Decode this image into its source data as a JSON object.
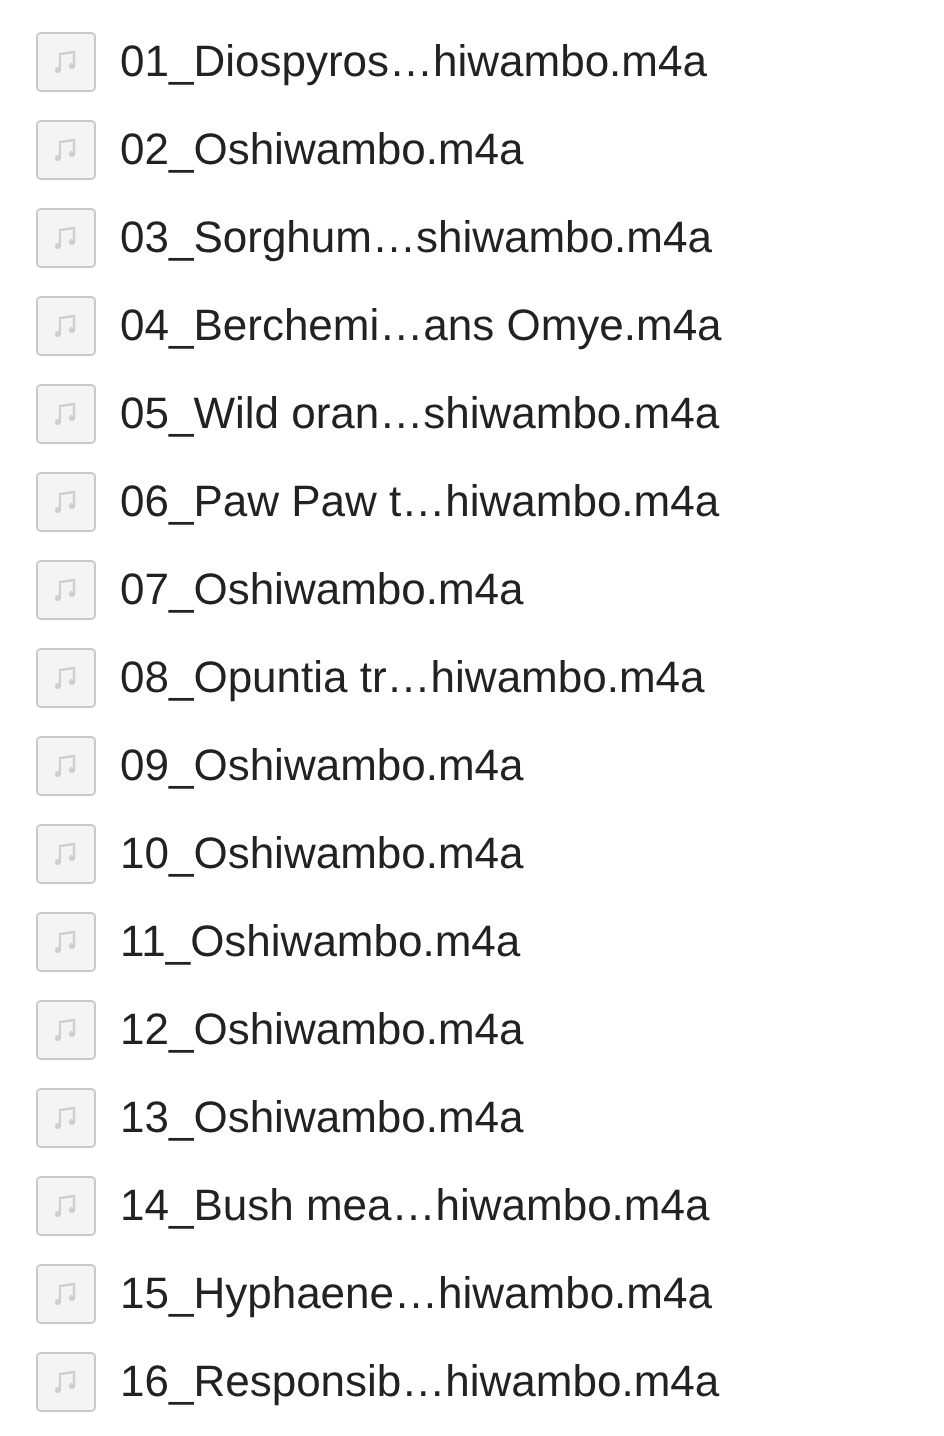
{
  "files": [
    {
      "name": "01_Diospyros…hiwambo.m4a"
    },
    {
      "name": "02_Oshiwambo.m4a"
    },
    {
      "name": "03_Sorghum…shiwambo.m4a"
    },
    {
      "name": "04_Berchemi…ans Omye.m4a"
    },
    {
      "name": "05_Wild oran…shiwambo.m4a"
    },
    {
      "name": "06_Paw Paw t…hiwambo.m4a"
    },
    {
      "name": "07_Oshiwambo.m4a"
    },
    {
      "name": "08_Opuntia tr…hiwambo.m4a"
    },
    {
      "name": "09_Oshiwambo.m4a"
    },
    {
      "name": "10_Oshiwambo.m4a"
    },
    {
      "name": "11_Oshiwambo.m4a"
    },
    {
      "name": "12_Oshiwambo.m4a"
    },
    {
      "name": "13_Oshiwambo.m4a"
    },
    {
      "name": "14_Bush mea…hiwambo.m4a"
    },
    {
      "name": "15_Hyphaene…hiwambo.m4a"
    },
    {
      "name": "16_Responsib…hiwambo.m4a"
    }
  ]
}
